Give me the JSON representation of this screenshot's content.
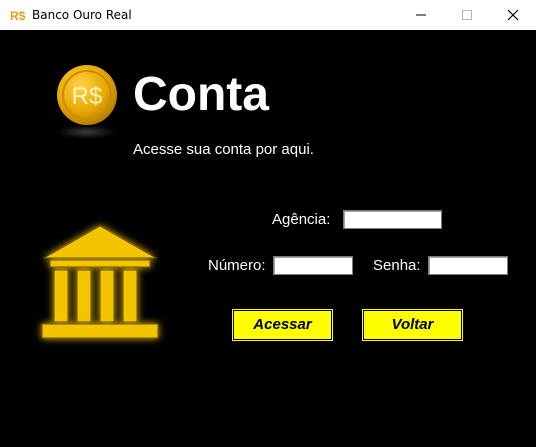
{
  "window": {
    "title": "Banco Ouro Real",
    "app_icon": "rs-currency-icon"
  },
  "controls": {
    "minimize": "minimize-icon",
    "maximize": "maximize-icon",
    "close": "close-icon"
  },
  "header": {
    "coin_text": "R$",
    "title": "Conta",
    "subtitle": "Acesse sua conta por aqui."
  },
  "form": {
    "agencia_label": "Agência:",
    "numero_label": "Número:",
    "senha_label": "Senha:",
    "agencia_value": "",
    "numero_value": "",
    "senha_value": ""
  },
  "buttons": {
    "acessar": "Acessar",
    "voltar": "Voltar"
  },
  "colors": {
    "background": "#000000",
    "accent": "#ffff00",
    "gold": "#f5c400"
  }
}
